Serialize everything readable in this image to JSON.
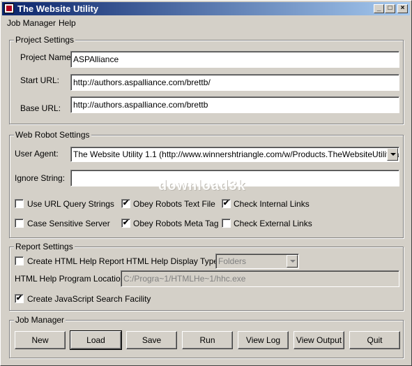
{
  "window": {
    "title": "The Website Utility",
    "min_glyph": "_",
    "max_glyph": "□",
    "close_glyph": "×"
  },
  "menu": {
    "items": [
      "Job Manager",
      "Help"
    ]
  },
  "project_settings": {
    "legend": "Project Settings",
    "project_name": {
      "label": "Project Name:",
      "value": "ASPAlliance"
    },
    "start_url": {
      "label": "Start URL:",
      "value": "http://authors.aspalliance.com/brettb/"
    },
    "base_url": {
      "label": "Base URL:",
      "value": "http://authors.aspalliance.com/brettb"
    }
  },
  "web_robot": {
    "legend": "Web Robot Settings",
    "user_agent": {
      "label": "User Agent:",
      "value": "The Website Utility 1.1 (http://www.winnershtriangle.com/w/Products.TheWebsiteUtility.asp)"
    },
    "ignore_string": {
      "label": "Ignore String:",
      "value": ""
    },
    "checkboxes": [
      {
        "label": "Use URL Query Strings",
        "checked": false
      },
      {
        "label": "Obey Robots Text File",
        "checked": true
      },
      {
        "label": "Check Internal Links",
        "checked": true
      },
      {
        "label": "Case Sensitive Server",
        "checked": false
      },
      {
        "label": "Obey Robots Meta Tag",
        "checked": true
      },
      {
        "label": "Check External Links",
        "checked": false
      }
    ],
    "check_mark": "✔"
  },
  "report": {
    "legend": "Report Settings",
    "create_html_help": {
      "label": "Create HTML Help Report",
      "checked": false
    },
    "display_type": {
      "label": "HTML Help Display Type:",
      "value": "Folders"
    },
    "program_location": {
      "label": "HTML Help Program Location:",
      "value": "C:/Progra~1/HTMLHe~1/hhc.exe"
    },
    "js_search": {
      "label": "Create JavaScript Search Facility",
      "checked": true
    }
  },
  "job_manager": {
    "legend": "Job Manager",
    "buttons": [
      "New",
      "Load",
      "Save",
      "Run",
      "View Log",
      "View Output",
      "Quit"
    ]
  },
  "watermark": "download3k"
}
